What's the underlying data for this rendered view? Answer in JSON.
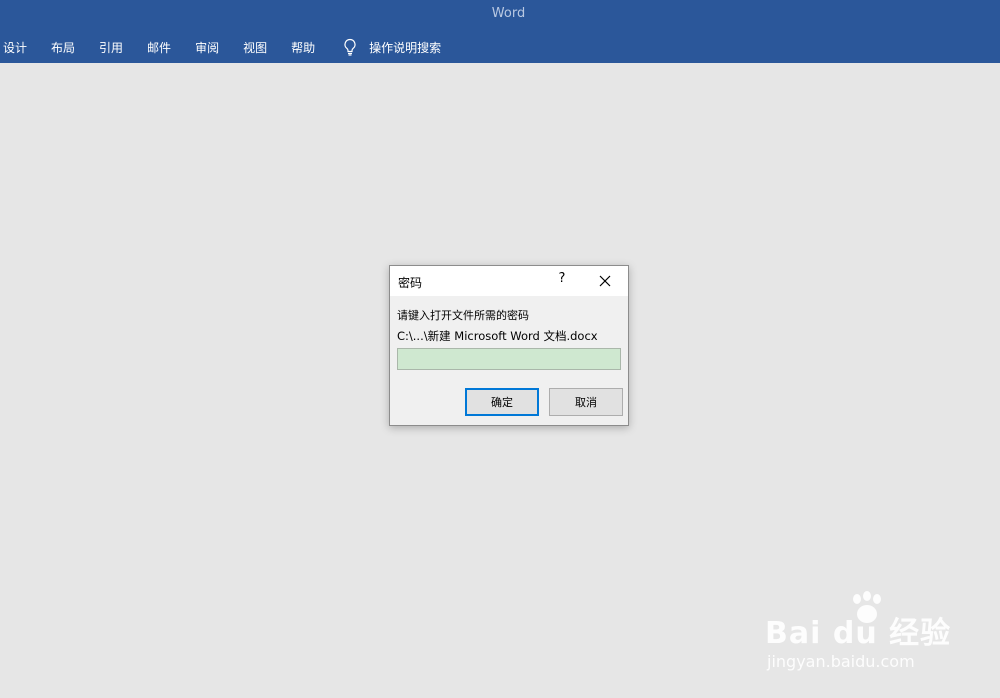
{
  "app": {
    "title": "Word"
  },
  "ribbon": {
    "tabs": [
      "设计",
      "布局",
      "引用",
      "邮件",
      "审阅",
      "视图",
      "帮助"
    ],
    "tell_me": "操作说明搜索"
  },
  "dialog": {
    "title": "密码",
    "help": "?",
    "prompt": "请键入打开文件所需的密码",
    "path": "C:\\...\\新建 Microsoft Word 文档.docx",
    "password_value": "",
    "ok_label": "确定",
    "cancel_label": "取消"
  },
  "watermark": {
    "brand": "Bai du 经验",
    "site": "jingyan.baidu.com"
  },
  "colors": {
    "title_bar": "#2b579a",
    "background": "#e6e6e6",
    "dialog_bg": "#f0f0f0",
    "input_bg": "#cfe8d0",
    "focus_border": "#0078d7"
  }
}
